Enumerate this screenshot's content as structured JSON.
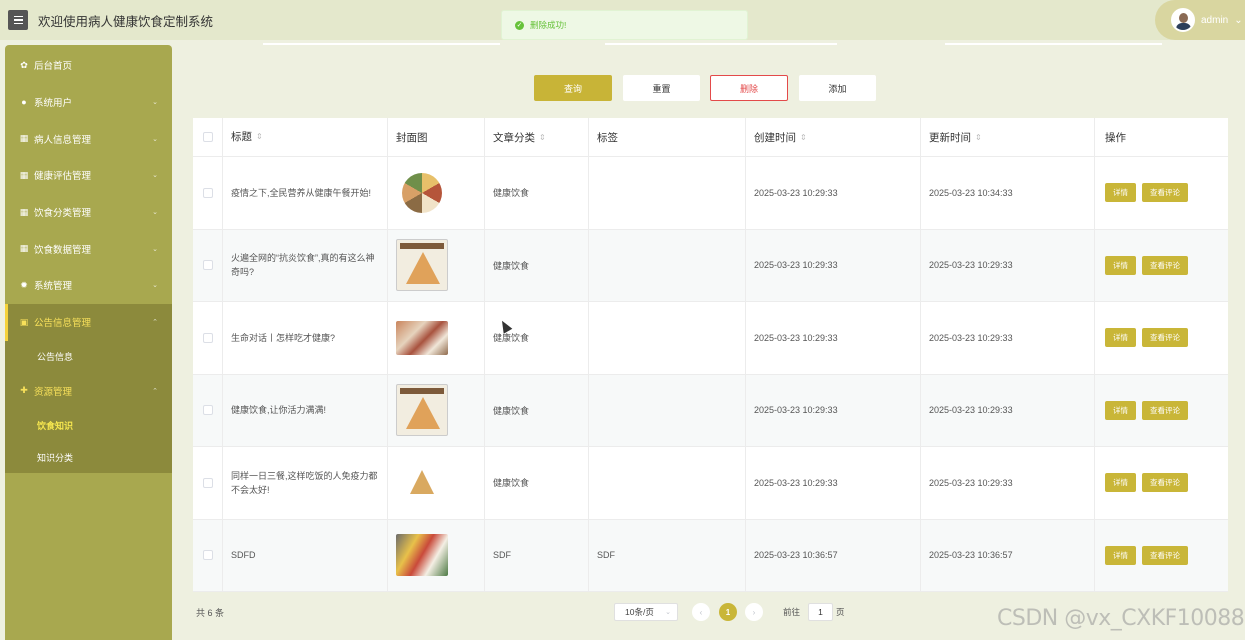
{
  "header": {
    "app_title": "欢迎使用病人健康饮食定制系统",
    "user_name": "admin"
  },
  "toast": {
    "message": "删除成功!"
  },
  "sidebar": {
    "items": [
      {
        "label": "后台首页",
        "icon": "home-icon"
      },
      {
        "label": "系统用户",
        "icon": "user-icon"
      },
      {
        "label": "病人信息管理",
        "icon": "grid-icon"
      },
      {
        "label": "健康评估管理",
        "icon": "grid-icon"
      },
      {
        "label": "饮食分类管理",
        "icon": "grid-icon"
      },
      {
        "label": "饮食数据管理",
        "icon": "grid-icon"
      },
      {
        "label": "系统管理",
        "icon": "gear-icon"
      },
      {
        "label": "公告信息管理",
        "icon": "notice-icon",
        "sub": [
          "公告信息"
        ]
      },
      {
        "label": "资源管理",
        "icon": "resource-icon",
        "sub": [
          "饮食知识",
          "知识分类"
        ]
      }
    ]
  },
  "toolbar": {
    "query_label": "查询",
    "reset_label": "重置",
    "delete_label": "删除",
    "add_label": "添加"
  },
  "table": {
    "headers": {
      "title": "标题",
      "cover": "封面图",
      "category": "文章分类",
      "tags": "标签",
      "created": "创建时间",
      "updated": "更新时间",
      "actions": "操作"
    },
    "detail_label": "详情",
    "comment_label": "查看评论",
    "rows": [
      {
        "title": "疫情之下,全民营养从健康午餐开始!",
        "category": "健康饮食",
        "tags": "",
        "created": "2025-03-23 10:29:33",
        "updated": "2025-03-23 10:34:33",
        "thumb": "round"
      },
      {
        "title": "火遍全网的“抗炎饮食”,真的有这么神奇吗?",
        "category": "健康饮食",
        "tags": "",
        "created": "2025-03-23 10:29:33",
        "updated": "2025-03-23 10:29:33",
        "thumb": "pyramid"
      },
      {
        "title": "生命对话丨怎样吃才健康?",
        "category": "健康饮食",
        "tags": "",
        "created": "2025-03-23 10:29:33",
        "updated": "2025-03-23 10:29:33",
        "thumb": "food"
      },
      {
        "title": "健康饮食,让你活力满满!",
        "category": "健康饮食",
        "tags": "",
        "created": "2025-03-23 10:29:33",
        "updated": "2025-03-23 10:29:33",
        "thumb": "pyramid"
      },
      {
        "title": "同样一日三餐,这样吃饭的人免疫力都不会太好!",
        "category": "健康饮食",
        "tags": "",
        "created": "2025-03-23 10:29:33",
        "updated": "2025-03-23 10:29:33",
        "thumb": "mini"
      },
      {
        "title": "SDFD",
        "category": "SDF",
        "tags": "SDF",
        "created": "2025-03-23 10:36:57",
        "updated": "2025-03-23 10:36:57",
        "thumb": "bento"
      }
    ]
  },
  "pagination": {
    "total_text": "共 6 条",
    "page_size": "10条/页",
    "current_page": "1",
    "goto_label": "前往",
    "goto_value": "1",
    "page_unit": "页"
  },
  "watermark": "CSDN @vx_CXKF10088",
  "colors": {
    "accent": "#c8b437",
    "sidebar": "#a8a84f",
    "danger": "#e34a4a",
    "success": "#67c23a"
  }
}
